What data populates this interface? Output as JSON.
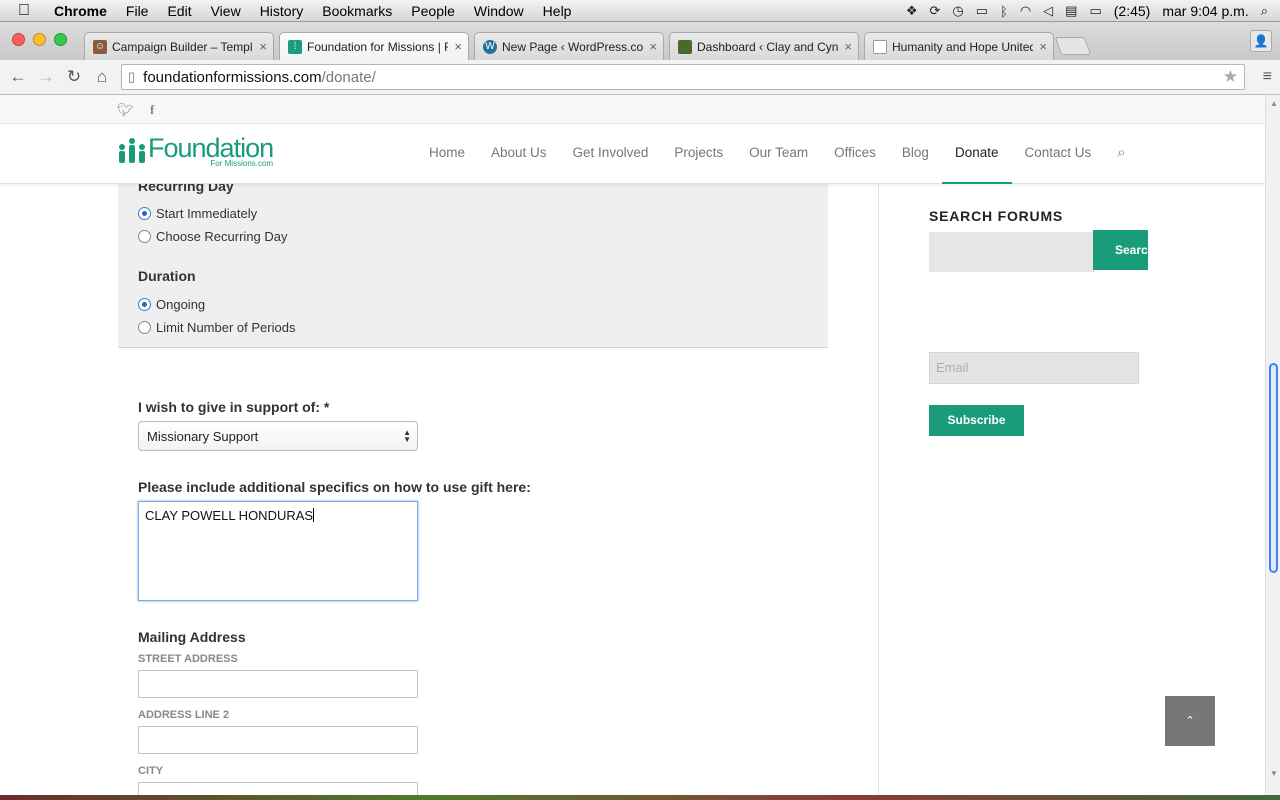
{
  "menubar": {
    "apple_glyph": "",
    "app_name": "Chrome",
    "items": [
      "File",
      "Edit",
      "View",
      "History",
      "Bookmarks",
      "People",
      "Window",
      "Help"
    ],
    "battery": "(2:45)",
    "clock": "mar 9:04 p.m."
  },
  "tabs": [
    {
      "title": "Campaign Builder – Templ",
      "favicon": "campaign-favicon",
      "color": "#8a5a3c"
    },
    {
      "title": "Foundation for Missions | F",
      "favicon": "foundation-favicon",
      "color": "#1a9b7a"
    },
    {
      "title": "New Page ‹ WordPress.co",
      "favicon": "wordpress-favicon",
      "color": "#21759b"
    },
    {
      "title": "Dashboard ‹ Clay and Cynt",
      "favicon": "dashboard-favicon",
      "color": "#4a6a2a"
    },
    {
      "title": "Humanity and Hope United",
      "favicon": "page-favicon",
      "color": "#ffffff"
    }
  ],
  "address_bar": {
    "host": "foundationformissions.com",
    "path": "/donate/"
  },
  "site": {
    "logo_word": "Foundation",
    "logo_sub": "For Missions.com",
    "nav": [
      "Home",
      "About Us",
      "Get Involved",
      "Projects",
      "Our Team",
      "Offices",
      "Blog",
      "Donate",
      "Contact Us"
    ],
    "active_nav": "Donate",
    "accent": "#1a9b7a"
  },
  "form": {
    "recurring_day_heading": "Recurring Day",
    "recurring_options": [
      "Start Immediately",
      "Choose Recurring Day"
    ],
    "duration_heading": "Duration",
    "duration_options": [
      "Ongoing",
      "Limit Number of Periods"
    ],
    "support_label": "I wish to give in support of: *",
    "support_value": "Missionary Support",
    "specifics_label": "Please include additional specifics on how to use gift here:",
    "specifics_value": "CLAY POWELL HONDURAS",
    "mailing_heading": "Mailing Address",
    "street_label": "STREET ADDRESS",
    "line2_label": "ADDRESS LINE 2",
    "city_label": "CITY"
  },
  "sidebar": {
    "search_title": "SEARCH FORUMS",
    "search_button": "Search",
    "email_placeholder": "Email",
    "subscribe_button": "Subscribe"
  }
}
